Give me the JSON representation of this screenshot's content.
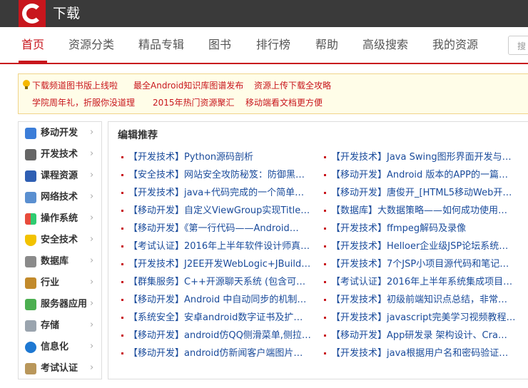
{
  "header": {
    "app_title": "下载"
  },
  "nav": {
    "items": [
      "首页",
      "资源分类",
      "精品专辑",
      "图书",
      "排行榜",
      "帮助",
      "高级搜索",
      "我的资源"
    ],
    "active": "首页",
    "search_placeholder": "搜"
  },
  "notice": {
    "links": [
      "下载频道图书版上线啦",
      "最全Android知识库图谱发布",
      "资源上传下载全攻略",
      "学院周年礼，折服你没道理",
      "2015年热门资源聚汇",
      "移动端看文档更方便"
    ]
  },
  "sidebar": {
    "items": [
      {
        "label": "移动开发",
        "icon": "mobile-icon"
      },
      {
        "label": "开发技术",
        "icon": "hammer-icon"
      },
      {
        "label": "课程资源",
        "icon": "book-icon"
      },
      {
        "label": "网络技术",
        "icon": "network-icon"
      },
      {
        "label": "操作系统",
        "icon": "windows-icon"
      },
      {
        "label": "安全技术",
        "icon": "shield-icon"
      },
      {
        "label": "数据库",
        "icon": "database-icon"
      },
      {
        "label": "行业",
        "icon": "industry-icon"
      },
      {
        "label": "服务器应用",
        "icon": "server-icon"
      },
      {
        "label": "存储",
        "icon": "printer-icon"
      },
      {
        "label": "信息化",
        "icon": "globe-icon"
      },
      {
        "label": "考试认证",
        "icon": "certificate-icon"
      }
    ],
    "arrow": "›"
  },
  "content": {
    "title": "编辑推荐",
    "left": [
      "【开发技术】Python源码剖析",
      "【安全技术】网站安全攻防秘笈：防御黑…",
      "【开发技术】java+代码完成的一个简单…",
      "【移动开发】自定义ViewGroup实现Title…",
      "【移动开发】《第一行代码——Android…",
      "【考试认证】2016年上半年软件设计师真…",
      "【开发技术】J2EE开发WebLogic+JBuild…",
      "【群集服务】C++开源聊天系统 (包含可…",
      "【移动开发】Android 中自动同步的机制…",
      "【系统安全】安卓android数字证书及扩…",
      "【移动开发】android仿QQ侧滑菜单,侧拉…",
      "【移动开发】android仿新闻客户端图片…"
    ],
    "right": [
      "【开发技术】Java Swing图形界面开发与…",
      "【移动开发】Android 版本的APP的一篇…",
      "【移动开发】唐俊开_[HTML5移动Web开…",
      "【数据库】大数据策略——如何成功使用…",
      "【开发技术】ffmpeg解码及录像",
      "【开发技术】Helloer企业级JSP论坛系统…",
      "【开发技术】7个JSP小项目源代码和笔记…",
      "【考试认证】2016年上半年系统集成项目…",
      "【开发技术】初级前端知识点总结，非常…",
      "【开发技术】javascript完美学习视频教程…",
      "【移动开发】App研发录 架构设计、Cra…",
      "【开发技术】java根据用户名和密码验证…"
    ]
  },
  "colors": {
    "brand": "#c8161d",
    "link": "#1a4b9b",
    "topbar": "#3a3a3a"
  }
}
